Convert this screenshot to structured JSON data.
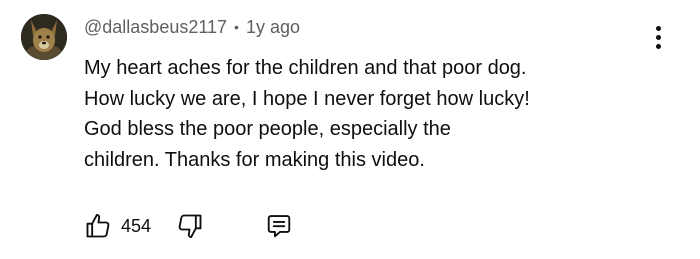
{
  "comment": {
    "author": "@dallasbeus2117",
    "separator": "•",
    "time": "1y ago",
    "lines": [
      "My heart aches for the children and that poor dog.",
      "How lucky we are, I hope I never forget how lucky!",
      "God bless the poor people, especially the",
      "children. Thanks for making this video."
    ],
    "like_count": "454"
  },
  "icons": {
    "like": "thumbs-up-icon",
    "dislike": "thumbs-down-icon",
    "reply": "reply-comment-icon",
    "more": "more-vertical-icon"
  },
  "colors": {
    "text": "#0f0f0f",
    "secondary_text": "#606060",
    "background": "#ffffff"
  }
}
